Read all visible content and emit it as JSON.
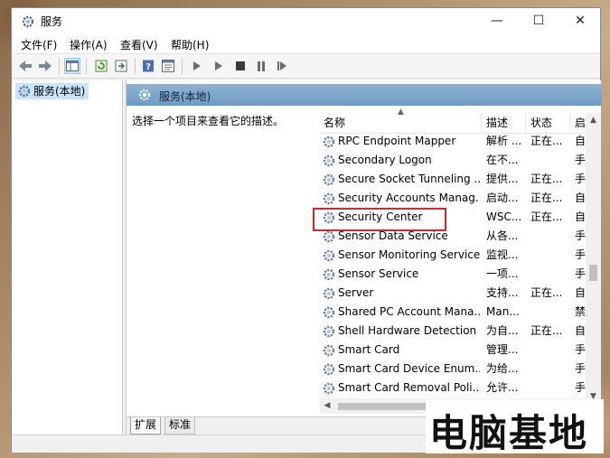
{
  "window": {
    "title": "服务",
    "min_symbol": "—",
    "max_symbol": "☐",
    "close_symbol": "✕"
  },
  "menu": [
    "文件(F)",
    "操作(A)",
    "查看(V)",
    "帮助(H)"
  ],
  "toolbar": {
    "icons": [
      "back-arrow-icon",
      "forward-arrow-icon",
      "show-hide-console-tree-icon",
      "refresh-icon",
      "export-list-icon",
      "help-icon",
      "properties-icon",
      "start-service-icon",
      "start-service-alt-icon",
      "stop-service-icon",
      "pause-service-icon",
      "restart-service-icon"
    ]
  },
  "tree": {
    "item": "服务(本地)"
  },
  "pane": {
    "header": "服务(本地)",
    "description": "选择一个项目来查看它的描述。"
  },
  "columns": {
    "name": "名称",
    "desc": "描述",
    "status": "状态",
    "start": "启"
  },
  "rows": [
    {
      "name": "RPC Endpoint Mapper",
      "desc": "解析 ...",
      "status": "正在...",
      "start": "自"
    },
    {
      "name": "Secondary Logon",
      "desc": "在不...",
      "status": "",
      "start": "手"
    },
    {
      "name": "Secure Socket Tunneling ...",
      "desc": "提供...",
      "status": "正在...",
      "start": "手"
    },
    {
      "name": "Security Accounts Manag...",
      "desc": "启动...",
      "status": "正在...",
      "start": "自"
    },
    {
      "name": "Security Center",
      "desc": "WSC...",
      "status": "正在...",
      "start": "自"
    },
    {
      "name": "Sensor Data Service",
      "desc": "从各...",
      "status": "",
      "start": "手"
    },
    {
      "name": "Sensor Monitoring Service",
      "desc": "监视...",
      "status": "",
      "start": "手"
    },
    {
      "name": "Sensor Service",
      "desc": "一项...",
      "status": "",
      "start": "手"
    },
    {
      "name": "Server",
      "desc": "支持...",
      "status": "正在...",
      "start": "自"
    },
    {
      "name": "Shared PC Account Mana...",
      "desc": "Man...",
      "status": "",
      "start": "禁"
    },
    {
      "name": "Shell Hardware Detection",
      "desc": "为自...",
      "status": "正在...",
      "start": "自"
    },
    {
      "name": "Smart Card",
      "desc": "管理...",
      "status": "",
      "start": "手"
    },
    {
      "name": "Smart Card Device Enum...",
      "desc": "为给...",
      "status": "",
      "start": "手"
    },
    {
      "name": "Smart Card Removal Poli...",
      "desc": "允许...",
      "status": "",
      "start": "手"
    }
  ],
  "highlighted_row": "Security Center",
  "tabs": [
    "扩展",
    "标准"
  ],
  "watermark": "电脑基地",
  "colors": {
    "highlight_box": "#d0282e",
    "pane_header": "#7fa5ca",
    "selection": "#cce4f7"
  }
}
